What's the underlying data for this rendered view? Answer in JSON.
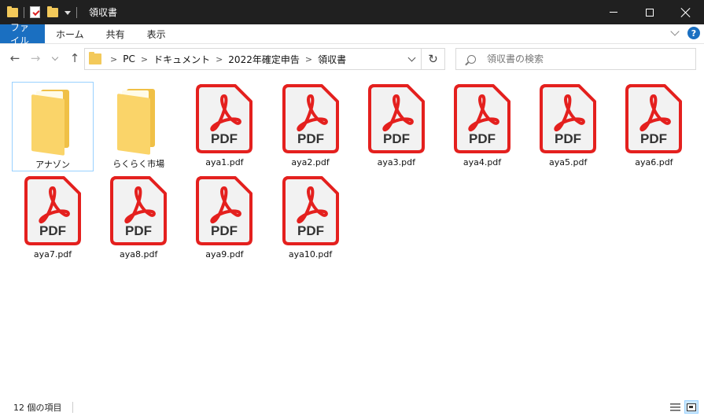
{
  "titlebar": {
    "title": "領収書",
    "quick_access_icons": [
      "folder-icon",
      "properties-check-icon",
      "new-folder-icon",
      "customize-dropdown-icon"
    ],
    "controls": [
      "minimize-icon",
      "maximize-icon",
      "close-icon"
    ]
  },
  "ribbon": {
    "tabs": [
      {
        "label": "ファイル",
        "active": true
      },
      {
        "label": "ホーム"
      },
      {
        "label": "共有"
      },
      {
        "label": "表示"
      }
    ],
    "help_label": "?"
  },
  "nav": {
    "back": "←",
    "forward": "→",
    "up": "↑",
    "refresh": "↻",
    "breadcrumbs": [
      "PC",
      "ドキュメント",
      "2022年確定申告",
      "領収書"
    ],
    "search_placeholder": "領収書の検索"
  },
  "items": [
    {
      "name": "アナゾン",
      "type": "folder",
      "selected": true
    },
    {
      "name": "らくらく市場",
      "type": "folder"
    },
    {
      "name": "aya1.pdf",
      "type": "pdf"
    },
    {
      "name": "aya2.pdf",
      "type": "pdf"
    },
    {
      "name": "aya3.pdf",
      "type": "pdf"
    },
    {
      "name": "aya4.pdf",
      "type": "pdf"
    },
    {
      "name": "aya5.pdf",
      "type": "pdf"
    },
    {
      "name": "aya6.pdf",
      "type": "pdf"
    },
    {
      "name": "aya7.pdf",
      "type": "pdf"
    },
    {
      "name": "aya8.pdf",
      "type": "pdf"
    },
    {
      "name": "aya9.pdf",
      "type": "pdf"
    },
    {
      "name": "aya10.pdf",
      "type": "pdf"
    }
  ],
  "pdf_icon_text": "PDF",
  "colors": {
    "titlebar_bg": "#202020",
    "file_tab": "#1a6fc1",
    "pdf_red": "#e4201e",
    "pdf_page": "#f2f2f2",
    "folder": "#fad469",
    "selection_border": "#99d1ff"
  },
  "status": {
    "item_count": "12 個の項目"
  }
}
